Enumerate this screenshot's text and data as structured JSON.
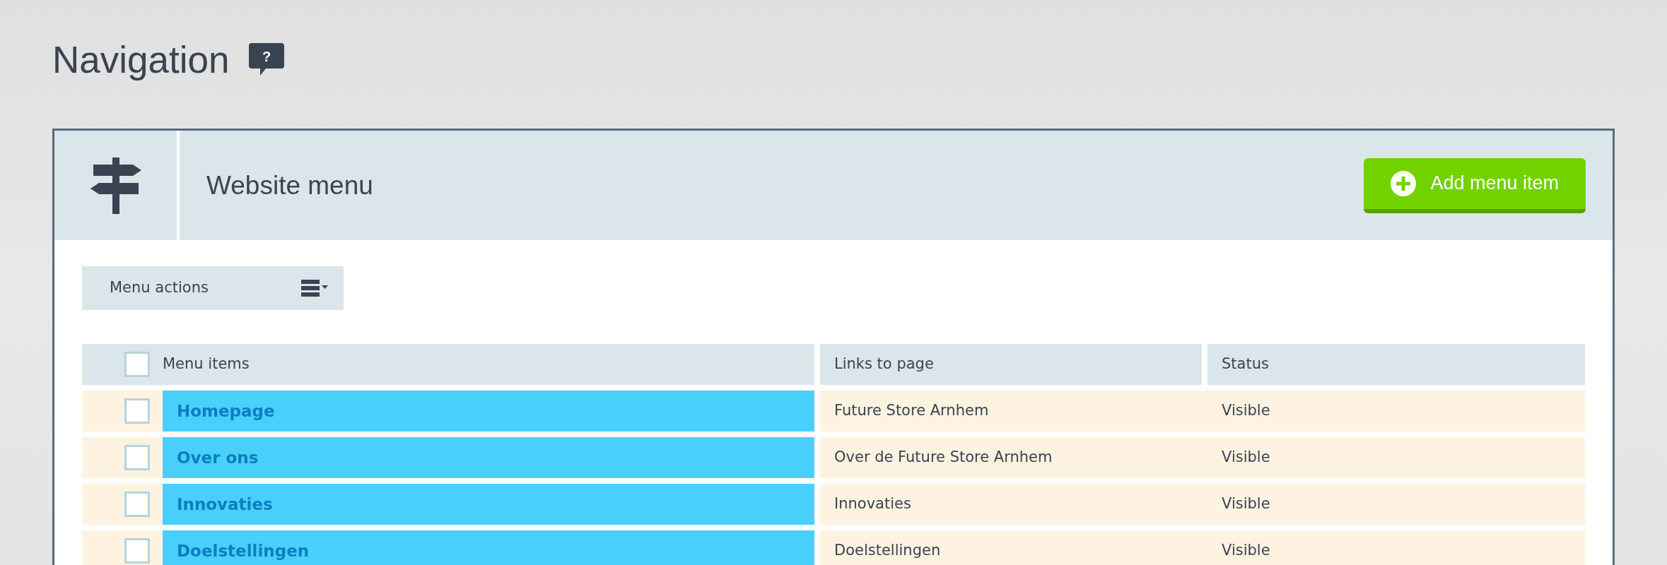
{
  "page": {
    "title": "Navigation",
    "help_glyph": "?"
  },
  "panel": {
    "title": "Website menu",
    "add_button": "Add menu item"
  },
  "menu_actions": {
    "label": "Menu actions"
  },
  "table": {
    "select_all": {
      "checked": false
    },
    "columns": [
      "Menu items",
      "Links to page",
      "Status"
    ],
    "rows": [
      {
        "checked": false,
        "name": "Homepage",
        "page": "Future Store Arnhem",
        "status": "Visible"
      },
      {
        "checked": false,
        "name": "Over ons",
        "page": "Over de Future Store Arnhem",
        "status": "Visible"
      },
      {
        "checked": false,
        "name": "Innovaties",
        "page": "Innovaties",
        "status": "Visible"
      },
      {
        "checked": false,
        "name": "Doelstellingen",
        "page": "Doelstellingen",
        "status": "Visible"
      }
    ]
  }
}
